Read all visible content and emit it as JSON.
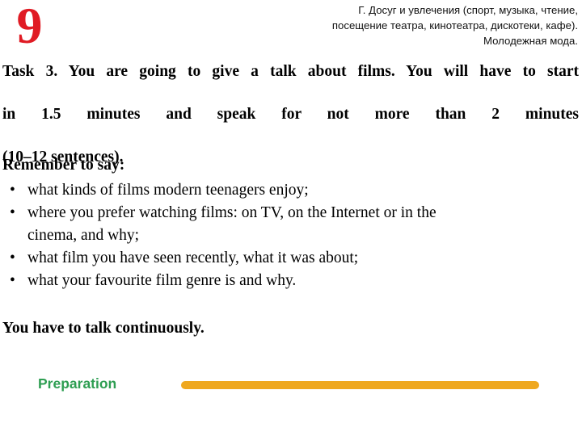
{
  "slide": {
    "number": "9",
    "number_color": "#e01b24",
    "background_color": "#ffffff"
  },
  "header": {
    "lines": [
      "Г. Досуг и увлечения (спорт, музыка, чтение,",
      "посещение театра, кинотеатра, дискотеки, кафе).",
      "Молодежная мода."
    ]
  },
  "task": {
    "paragraph_lines": [
      "Task 3. You are going to give a talk about films. You will have to start",
      "in 1.5 minutes and speak for not more than 2 minutes",
      "(10–12 sentences)."
    ],
    "full_text": "Task 3. You are going to give a talk about films. You will have to start in 1.5 minutes and speak for not more than 2 minutes (10–12 sentences)."
  },
  "remember": {
    "heading": "Remember to say:",
    "bullet_marker": "•",
    "bullets": [
      {
        "line1": "what kinds of films modern teenagers enjoy;",
        "line2": ""
      },
      {
        "line1": "where you prefer watching films: on TV, on the Internet or in the",
        "line2": "cinema, and why;"
      },
      {
        "line1": "what film you have seen recently, what  it was about;",
        "line2": ""
      },
      {
        "line1": "what your favourite film genre is and why.",
        "line2": ""
      }
    ]
  },
  "closing": {
    "text": "You have to talk continuously."
  },
  "footer": {
    "preparation_label": "Preparation",
    "preparation_color": "#2e9e52",
    "bar_color": "#efa81f"
  }
}
